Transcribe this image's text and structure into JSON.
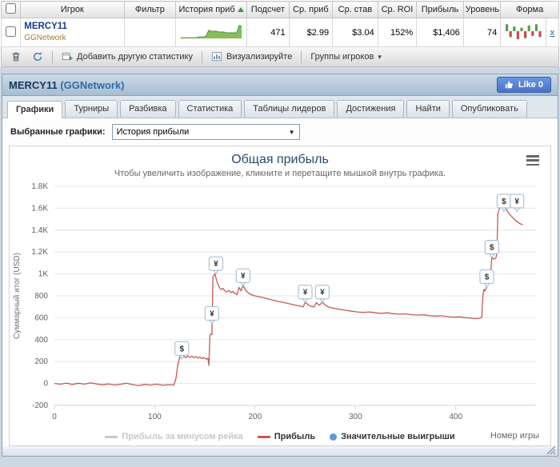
{
  "stats_table": {
    "columns": [
      {
        "label": "Игрок"
      },
      {
        "label": "Фильтр"
      },
      {
        "label": "История приб",
        "sorted": true
      },
      {
        "label": "Подсчет"
      },
      {
        "label": "Ср. приб"
      },
      {
        "label": "Ср. став"
      },
      {
        "label": "Ср. ROI"
      },
      {
        "label": "Прибыль"
      },
      {
        "label": "Уровень"
      },
      {
        "label": "Форма"
      }
    ],
    "row": {
      "player": "MERCY11",
      "network": "GGNetwork",
      "filter": "",
      "count": "471",
      "avg_profit": "$2.99",
      "avg_stake": "$3.04",
      "avg_roi": "152%",
      "profit": "$1,406",
      "level": "74",
      "remove_label": "x",
      "sparkline": [
        0,
        0,
        0,
        0,
        0,
        0,
        0,
        1,
        1,
        1,
        2,
        9,
        8,
        8,
        8,
        7,
        7,
        7,
        6,
        6,
        6,
        6,
        6,
        15,
        14
      ],
      "form": [
        6,
        -5,
        4,
        -7,
        3,
        -6,
        5,
        -4,
        6,
        -5
      ]
    }
  },
  "toolbar": {
    "add_stat_label": "Добавить другую статистику",
    "visualize_label": "Визуализируйте",
    "groups_label": "Группы игроков"
  },
  "panel": {
    "title_player": "MERCY11",
    "title_network": "(GGNetwork)",
    "like_label": "Like 0"
  },
  "tabs": [
    {
      "id": "graphs",
      "label": "Графики",
      "active": true
    },
    {
      "id": "tournaments",
      "label": "Турниры",
      "active": false
    },
    {
      "id": "breakdown",
      "label": "Разбивка",
      "active": false
    },
    {
      "id": "statistics",
      "label": "Статистика",
      "active": false
    },
    {
      "id": "leaderboards",
      "label": "Таблицы лидеров",
      "active": false
    },
    {
      "id": "achievements",
      "label": "Достижения",
      "active": false
    },
    {
      "id": "find",
      "label": "Найти",
      "active": false
    },
    {
      "id": "publish",
      "label": "Опубликовать",
      "active": false
    }
  ],
  "graph_select": {
    "label": "Выбранные графики:",
    "value": "История прибыли"
  },
  "chart_data": {
    "type": "line",
    "title": "Общая прибыль",
    "subtitle": "Чтобы увеличить изображение, кликните и перетащите мышкой внутрь графика.",
    "xlabel": "Номер игры",
    "ylabel": "Суммарный итог (USD)",
    "xlim": [
      0,
      480
    ],
    "ylim": [
      -200,
      1800
    ],
    "grid": true,
    "legend_position": "bottom",
    "xticks": [
      {
        "v": 0,
        "label": "0"
      },
      {
        "v": 100,
        "label": "100"
      },
      {
        "v": 200,
        "label": "200"
      },
      {
        "v": 300,
        "label": "300"
      },
      {
        "v": 400,
        "label": "400"
      }
    ],
    "yticks": [
      {
        "v": -200,
        "label": "-200"
      },
      {
        "v": 0,
        "label": "0"
      },
      {
        "v": 200,
        "label": "200"
      },
      {
        "v": 400,
        "label": "400"
      },
      {
        "v": 600,
        "label": "600"
      },
      {
        "v": 800,
        "label": "800"
      },
      {
        "v": 1000,
        "label": "1K"
      },
      {
        "v": 1200,
        "label": "1.2K"
      },
      {
        "v": 1400,
        "label": "1.4K"
      },
      {
        "v": 1600,
        "label": "1.6K"
      },
      {
        "v": 1800,
        "label": "1.8K"
      }
    ],
    "legend": [
      {
        "label": "Прибыль за минусом рейка",
        "color": "#c8c8c8",
        "swatch": "line",
        "disabled": true
      },
      {
        "label": "Прибыль",
        "color": "#c45a52",
        "swatch": "line",
        "disabled": false
      },
      {
        "label": "Значительные выигрыши",
        "color": "#5b9bd5",
        "swatch": "circle",
        "disabled": false
      }
    ],
    "series": [
      {
        "name": "Прибыль за минусом рейка",
        "color": "#c8c8c8",
        "visible": false,
        "points": []
      },
      {
        "name": "Прибыль",
        "color": "#c45a52",
        "visible": true,
        "points": [
          [
            0,
            0
          ],
          [
            6,
            -6
          ],
          [
            12,
            4
          ],
          [
            18,
            -8
          ],
          [
            24,
            2
          ],
          [
            30,
            -6
          ],
          [
            36,
            6
          ],
          [
            42,
            -4
          ],
          [
            48,
            -12
          ],
          [
            54,
            -4
          ],
          [
            60,
            -14
          ],
          [
            66,
            -6
          ],
          [
            72,
            2
          ],
          [
            78,
            -10
          ],
          [
            84,
            -18
          ],
          [
            90,
            -8
          ],
          [
            96,
            -14
          ],
          [
            102,
            -6
          ],
          [
            108,
            -16
          ],
          [
            114,
            -10
          ],
          [
            119,
            -14
          ],
          [
            121,
            40
          ],
          [
            123,
            170
          ],
          [
            125,
            245
          ],
          [
            127,
            230
          ],
          [
            129,
            248
          ],
          [
            131,
            236
          ],
          [
            133,
            252
          ],
          [
            135,
            238
          ],
          [
            137,
            250
          ],
          [
            139,
            236
          ],
          [
            141,
            246
          ],
          [
            143,
            232
          ],
          [
            145,
            242
          ],
          [
            147,
            228
          ],
          [
            149,
            238
          ],
          [
            151,
            222
          ],
          [
            153,
            230
          ],
          [
            154,
            165
          ],
          [
            155,
            440
          ],
          [
            156,
            455
          ],
          [
            157,
            445
          ],
          [
            158,
            975
          ],
          [
            160,
            1000
          ],
          [
            162,
            930
          ],
          [
            164,
            885
          ],
          [
            166,
            858
          ],
          [
            168,
            868
          ],
          [
            170,
            845
          ],
          [
            172,
            838
          ],
          [
            174,
            850
          ],
          [
            176,
            830
          ],
          [
            178,
            840
          ],
          [
            180,
            822
          ],
          [
            182,
            812
          ],
          [
            184,
            878
          ],
          [
            186,
            845
          ],
          [
            188,
            895
          ],
          [
            190,
            862
          ],
          [
            192,
            838
          ],
          [
            194,
            822
          ],
          [
            196,
            812
          ],
          [
            199,
            802
          ],
          [
            204,
            792
          ],
          [
            209,
            782
          ],
          [
            214,
            770
          ],
          [
            219,
            758
          ],
          [
            224,
            748
          ],
          [
            229,
            738
          ],
          [
            234,
            728
          ],
          [
            239,
            718
          ],
          [
            244,
            708
          ],
          [
            248,
            700
          ],
          [
            250,
            742
          ],
          [
            253,
            718
          ],
          [
            256,
            704
          ],
          [
            259,
            700
          ],
          [
            261,
            738
          ],
          [
            264,
            714
          ],
          [
            267,
            742
          ],
          [
            270,
            716
          ],
          [
            273,
            700
          ],
          [
            277,
            690
          ],
          [
            282,
            681
          ],
          [
            287,
            673
          ],
          [
            292,
            666
          ],
          [
            297,
            659
          ],
          [
            302,
            653
          ],
          [
            308,
            649
          ],
          [
            314,
            653
          ],
          [
            320,
            645
          ],
          [
            326,
            641
          ],
          [
            332,
            645
          ],
          [
            338,
            637
          ],
          [
            344,
            633
          ],
          [
            350,
            636
          ],
          [
            356,
            628
          ],
          [
            362,
            624
          ],
          [
            368,
            627
          ],
          [
            374,
            619
          ],
          [
            380,
            615
          ],
          [
            386,
            618
          ],
          [
            392,
            610
          ],
          [
            398,
            606
          ],
          [
            404,
            609
          ],
          [
            410,
            601
          ],
          [
            415,
            596
          ],
          [
            420,
            592
          ],
          [
            424,
            596
          ],
          [
            426,
            604
          ],
          [
            427,
            790
          ],
          [
            428,
            860
          ],
          [
            429,
            845
          ],
          [
            431,
            880
          ],
          [
            432,
            1010
          ],
          [
            433,
            995
          ],
          [
            435,
            1025
          ],
          [
            436,
            1150
          ],
          [
            438,
            1135
          ],
          [
            440,
            1145
          ],
          [
            441,
            1190
          ],
          [
            442,
            1550
          ],
          [
            444,
            1615
          ],
          [
            446,
            1650
          ],
          [
            448,
            1628
          ],
          [
            450,
            1598
          ],
          [
            452,
            1565
          ],
          [
            455,
            1532
          ],
          [
            458,
            1502
          ],
          [
            461,
            1478
          ],
          [
            464,
            1460
          ],
          [
            467,
            1448
          ]
        ]
      }
    ],
    "markers": [
      {
        "x": 127,
        "y": 320,
        "symbol": "$"
      },
      {
        "x": 157,
        "y": 640,
        "symbol": "¥"
      },
      {
        "x": 161,
        "y": 1095,
        "symbol": "¥"
      },
      {
        "x": 188,
        "y": 985,
        "symbol": "¥"
      },
      {
        "x": 250,
        "y": 835,
        "symbol": "¥"
      },
      {
        "x": 267,
        "y": 835,
        "symbol": "¥"
      },
      {
        "x": 431,
        "y": 975,
        "symbol": "$"
      },
      {
        "x": 436,
        "y": 1245,
        "symbol": "$"
      },
      {
        "x": 448,
        "y": 1665,
        "symbol": "$"
      },
      {
        "x": 461,
        "y": 1665,
        "symbol": "¥"
      }
    ]
  },
  "colors": {
    "profit_line": "#c45a52",
    "significant_win_blue": "#5b9bd5",
    "sparkline_green": "#7ab648",
    "form_up": "#52a052",
    "form_down": "#c0504d",
    "like_blue": "#4a72c4",
    "chart_title": "#274b6d"
  },
  "icons": [
    "trash-icon",
    "refresh-icon",
    "add-statistic-icon",
    "visualize-icon",
    "chevron-down-icon",
    "thumbs-up-icon",
    "sort-ascending-icon",
    "dropdown-arrow-icon",
    "hamburger-menu-icon",
    "resize-handle-icon"
  ]
}
